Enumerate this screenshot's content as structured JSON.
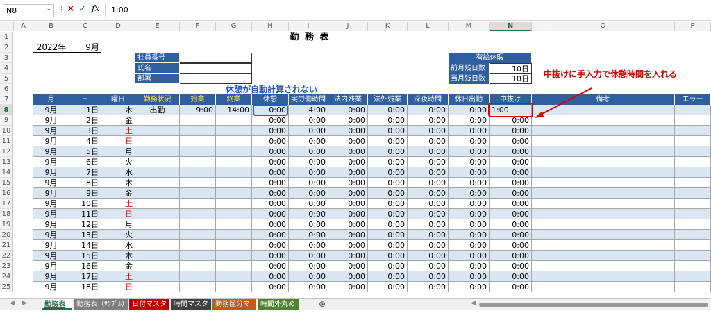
{
  "formula_bar": {
    "name_box": "N8",
    "value": "1:00"
  },
  "columns": [
    "A",
    "B",
    "C",
    "D",
    "E",
    "F",
    "G",
    "H",
    "I",
    "J",
    "K",
    "L",
    "M",
    "N",
    "O",
    "P"
  ],
  "title": "勤 務 表",
  "year": "2022年",
  "month": "9月",
  "info_labels": [
    "社員番号",
    "氏名",
    "部署"
  ],
  "paid_leave": {
    "header": "有給休暇",
    "prev_label": "前月残日数",
    "prev_value": "10日",
    "curr_label": "当月残日数",
    "curr_value": "10日"
  },
  "annotations": {
    "break_note": "休憩が自動計算されない",
    "manual_note": "中抜けに手入力で休憩時間を入れる"
  },
  "headers": [
    "月",
    "日",
    "曜日",
    "勤務状況",
    "始業",
    "終業",
    "休憩",
    "実労働時間",
    "法内残業",
    "法外残業",
    "深夜時間",
    "休日出勤",
    "中抜け",
    "備考",
    "エラー"
  ],
  "rows": [
    {
      "m": "9月",
      "d": "1日",
      "w": "木",
      "st": "出勤",
      "s": "9:00",
      "e": "14:00",
      "brk": "0:00",
      "work": "4:00",
      "in": "0:00",
      "out": "0:00",
      "night": "0:00",
      "hol": "0:00",
      "nk": "1:00",
      "red": false
    },
    {
      "m": "9月",
      "d": "2日",
      "w": "金",
      "st": "",
      "s": "",
      "e": "",
      "brk": "0:00",
      "work": "0:00",
      "in": "0:00",
      "out": "0:00",
      "night": "0:00",
      "hol": "0:00",
      "nk": "0:00",
      "red": false
    },
    {
      "m": "9月",
      "d": "3日",
      "w": "土",
      "st": "",
      "s": "",
      "e": "",
      "brk": "0:00",
      "work": "0:00",
      "in": "0:00",
      "out": "0:00",
      "night": "0:00",
      "hol": "0:00",
      "nk": "0:00",
      "red": true
    },
    {
      "m": "9月",
      "d": "4日",
      "w": "日",
      "st": "",
      "s": "",
      "e": "",
      "brk": "0:00",
      "work": "0:00",
      "in": "0:00",
      "out": "0:00",
      "night": "0:00",
      "hol": "0:00",
      "nk": "0:00",
      "red": true
    },
    {
      "m": "9月",
      "d": "5日",
      "w": "月",
      "st": "",
      "s": "",
      "e": "",
      "brk": "0:00",
      "work": "0:00",
      "in": "0:00",
      "out": "0:00",
      "night": "0:00",
      "hol": "0:00",
      "nk": "0:00",
      "red": false
    },
    {
      "m": "9月",
      "d": "6日",
      "w": "火",
      "st": "",
      "s": "",
      "e": "",
      "brk": "0:00",
      "work": "0:00",
      "in": "0:00",
      "out": "0:00",
      "night": "0:00",
      "hol": "0:00",
      "nk": "0:00",
      "red": false
    },
    {
      "m": "9月",
      "d": "7日",
      "w": "水",
      "st": "",
      "s": "",
      "e": "",
      "brk": "0:00",
      "work": "0:00",
      "in": "0:00",
      "out": "0:00",
      "night": "0:00",
      "hol": "0:00",
      "nk": "0:00",
      "red": false
    },
    {
      "m": "9月",
      "d": "8日",
      "w": "木",
      "st": "",
      "s": "",
      "e": "",
      "brk": "0:00",
      "work": "0:00",
      "in": "0:00",
      "out": "0:00",
      "night": "0:00",
      "hol": "0:00",
      "nk": "0:00",
      "red": false
    },
    {
      "m": "9月",
      "d": "9日",
      "w": "金",
      "st": "",
      "s": "",
      "e": "",
      "brk": "0:00",
      "work": "0:00",
      "in": "0:00",
      "out": "0:00",
      "night": "0:00",
      "hol": "0:00",
      "nk": "0:00",
      "red": false
    },
    {
      "m": "9月",
      "d": "10日",
      "w": "土",
      "st": "",
      "s": "",
      "e": "",
      "brk": "0:00",
      "work": "0:00",
      "in": "0:00",
      "out": "0:00",
      "night": "0:00",
      "hol": "0:00",
      "nk": "0:00",
      "red": true
    },
    {
      "m": "9月",
      "d": "11日",
      "w": "日",
      "st": "",
      "s": "",
      "e": "",
      "brk": "0:00",
      "work": "0:00",
      "in": "0:00",
      "out": "0:00",
      "night": "0:00",
      "hol": "0:00",
      "nk": "0:00",
      "red": true
    },
    {
      "m": "9月",
      "d": "12日",
      "w": "月",
      "st": "",
      "s": "",
      "e": "",
      "brk": "0:00",
      "work": "0:00",
      "in": "0:00",
      "out": "0:00",
      "night": "0:00",
      "hol": "0:00",
      "nk": "0:00",
      "red": false
    },
    {
      "m": "9月",
      "d": "13日",
      "w": "火",
      "st": "",
      "s": "",
      "e": "",
      "brk": "0:00",
      "work": "0:00",
      "in": "0:00",
      "out": "0:00",
      "night": "0:00",
      "hol": "0:00",
      "nk": "0:00",
      "red": false
    },
    {
      "m": "9月",
      "d": "14日",
      "w": "水",
      "st": "",
      "s": "",
      "e": "",
      "brk": "0:00",
      "work": "0:00",
      "in": "0:00",
      "out": "0:00",
      "night": "0:00",
      "hol": "0:00",
      "nk": "0:00",
      "red": false
    },
    {
      "m": "9月",
      "d": "15日",
      "w": "木",
      "st": "",
      "s": "",
      "e": "",
      "brk": "0:00",
      "work": "0:00",
      "in": "0:00",
      "out": "0:00",
      "night": "0:00",
      "hol": "0:00",
      "nk": "0:00",
      "red": false
    },
    {
      "m": "9月",
      "d": "16日",
      "w": "金",
      "st": "",
      "s": "",
      "e": "",
      "brk": "0:00",
      "work": "0:00",
      "in": "0:00",
      "out": "0:00",
      "night": "0:00",
      "hol": "0:00",
      "nk": "0:00",
      "red": false
    },
    {
      "m": "9月",
      "d": "17日",
      "w": "土",
      "st": "",
      "s": "",
      "e": "",
      "brk": "0:00",
      "work": "0:00",
      "in": "0:00",
      "out": "0:00",
      "night": "0:00",
      "hol": "0:00",
      "nk": "0:00",
      "red": true
    },
    {
      "m": "9月",
      "d": "18日",
      "w": "日",
      "st": "",
      "s": "",
      "e": "",
      "brk": "0:00",
      "work": "0:00",
      "in": "0:00",
      "out": "0:00",
      "night": "0:00",
      "hol": "0:00",
      "nk": "0:00",
      "red": true
    }
  ],
  "sheet_tabs": [
    {
      "label": "勤務表",
      "bg": "#ffffff",
      "fg": "#1f7244"
    },
    {
      "label": "勤務表（ｻﾝﾌﾟﾙ）",
      "bg": "#7f7f7f",
      "fg": "#ffffff"
    },
    {
      "label": "日付マスタ",
      "bg": "#c00000",
      "fg": "#ffffff"
    },
    {
      "label": "時間マスタ",
      "bg": "#404040",
      "fg": "#ffffff"
    },
    {
      "label": "勤務区分マスタ",
      "bg": "#c55a11",
      "fg": "#ffffff"
    },
    {
      "label": "時間外丸め",
      "bg": "#548235",
      "fg": "#ffffff"
    }
  ]
}
